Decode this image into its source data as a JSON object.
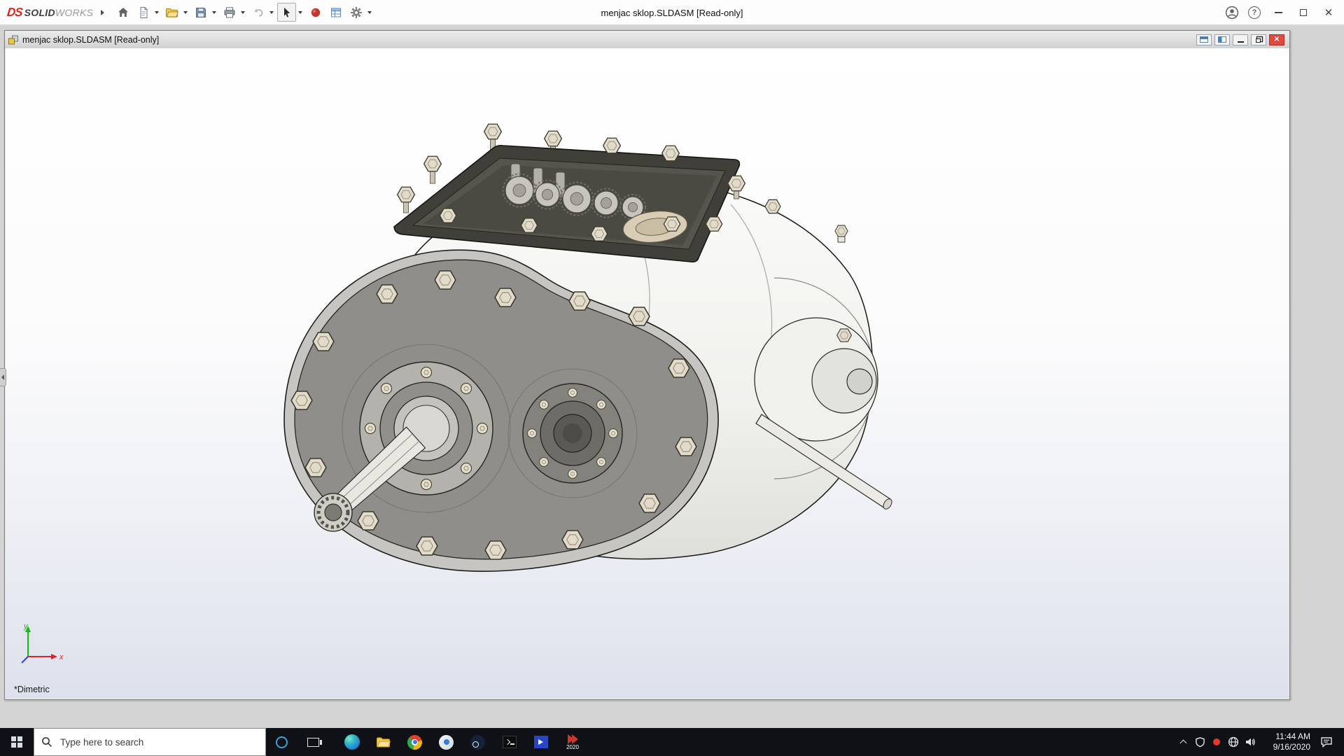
{
  "window": {
    "title": "menjac sklop.SLDASM [Read-only]",
    "brand": {
      "logo": "DS",
      "solid": "SOLID",
      "works": "WORKS"
    }
  },
  "icons": {
    "close": "✕",
    "help": "?"
  },
  "doc": {
    "title": "menjac sklop.SLDASM [Read-only]",
    "view_orientation": "*Dimetric"
  },
  "triad": {
    "x": "x",
    "y": "y"
  },
  "taskbar": {
    "search_placeholder": "Type here to search",
    "solidworks_year": "2020",
    "time": "11:44 AM",
    "date": "9/16/2020"
  }
}
